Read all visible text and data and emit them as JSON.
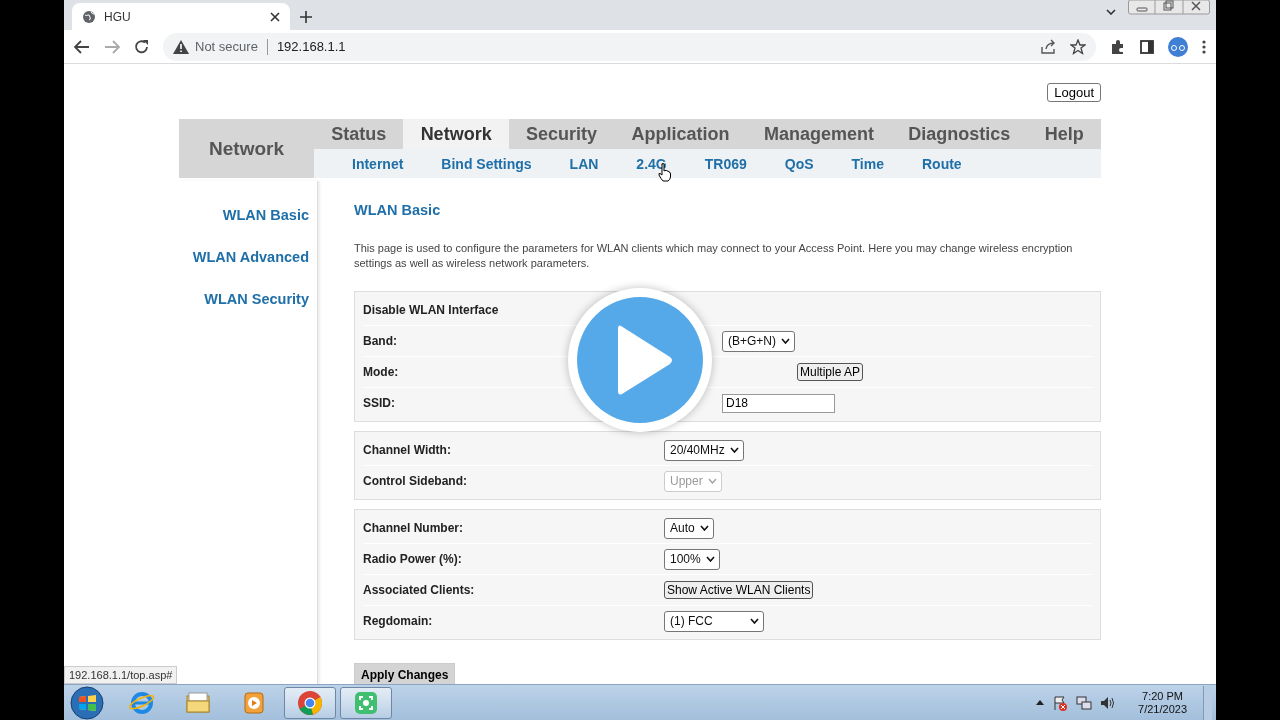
{
  "browser": {
    "tab_title": "HGU",
    "security_label": "Not secure",
    "url": "192.168.1.1"
  },
  "logout": "Logout",
  "nav": {
    "section": "Network",
    "tabs": [
      {
        "label": "Status",
        "selected": false
      },
      {
        "label": "Network",
        "selected": true
      },
      {
        "label": "Security",
        "selected": false
      },
      {
        "label": "Application",
        "selected": false
      },
      {
        "label": "Management",
        "selected": false
      },
      {
        "label": "Diagnostics",
        "selected": false
      },
      {
        "label": "Help",
        "selected": false
      }
    ],
    "subtabs": [
      "Internet",
      "Bind Settings",
      "LAN",
      "2.4G",
      "TR069",
      "QoS",
      "Time",
      "Route"
    ]
  },
  "sidebar": [
    "WLAN Basic",
    "WLAN Advanced",
    "WLAN Security"
  ],
  "title": "WLAN Basic",
  "description": "This page is used to configure the parameters for WLAN clients which may connect to your Access Point. Here you may change wireless encryption settings as well as wireless network parameters.",
  "sections": [
    [
      {
        "label": "Disable WLAN Interface"
      },
      {
        "label": "Band:",
        "control": {
          "kind": "select",
          "value": "(B+G+N)",
          "disabled": false
        }
      },
      {
        "label": "Mode:",
        "control": {
          "kind": "button",
          "value": "Multiple AP",
          "disabled": false
        }
      },
      {
        "label": "SSID:",
        "control": {
          "kind": "input",
          "value": "D18",
          "disabled": false
        }
      }
    ],
    [
      {
        "label": "Channel Width:",
        "control": {
          "kind": "select",
          "value": "20/40MHz",
          "disabled": false
        }
      },
      {
        "label": "Control Sideband:",
        "control": {
          "kind": "select",
          "value": "Upper",
          "disabled": true
        }
      }
    ],
    [
      {
        "label": "Channel Number:",
        "control": {
          "kind": "select",
          "value": "Auto",
          "disabled": false
        }
      },
      {
        "label": "Radio Power (%):",
        "control": {
          "kind": "select",
          "value": "100%",
          "disabled": false
        }
      },
      {
        "label": "Associated Clients:",
        "control": {
          "kind": "button",
          "value": "Show Active WLAN Clients",
          "disabled": false
        }
      },
      {
        "label": "Regdomain:",
        "control": {
          "kind": "select",
          "value": "(1) FCC",
          "disabled": false
        }
      }
    ]
  ],
  "apply": "Apply Changes",
  "status_url": "192.168.1.1/top.asp#",
  "taskbar": {
    "apps": [
      {
        "kind": "ie",
        "open": false
      },
      {
        "kind": "folder",
        "open": false
      },
      {
        "kind": "media",
        "open": false
      },
      {
        "kind": "chrome",
        "open": true
      },
      {
        "kind": "recorder",
        "open": true
      }
    ],
    "time": "7:20 PM",
    "date": "7/21/2023"
  }
}
